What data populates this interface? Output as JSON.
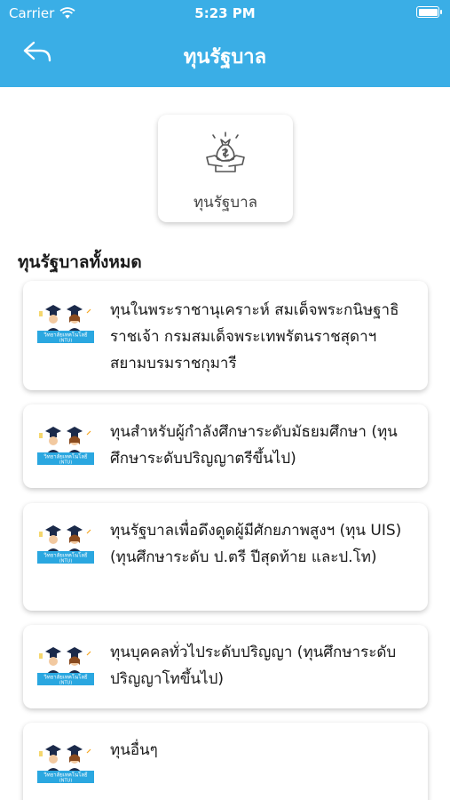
{
  "status_bar": {
    "carrier": "Carrier",
    "time": "5:23 PM"
  },
  "nav": {
    "title": "ทุนรัฐบาล",
    "back_icon": "back-arrow-icon"
  },
  "category": {
    "label": "ทุนรัฐบาล",
    "icon": "money-bag-hands-icon"
  },
  "section": {
    "title": "ทุนรัฐบาลทั้งหมด"
  },
  "scholarships": [
    {
      "title": "ทุนในพระราชานุเคราะห์ สมเด็จพระกนิษฐาธิราชเจ้า กรมสมเด็จพระเทพรัตนราชสุดาฯ สยามบรมราชกุมารี"
    },
    {
      "title": "ทุนสำหรับผู้กำลังศึกษาระดับมัธยมศึกษา (ทุนศึกษาระดับปริญญาตรีขึ้นไป)"
    },
    {
      "title": "ทุนรัฐบาลเพื่อดึงดูดผู้มีศักยภาพสูงฯ (ทุน UIS)(ทุนศึกษาระดับ ป.ตรี ปีสุดท้าย และป.โท)"
    },
    {
      "title": "ทุนบุคคลทั่วไประดับปริญญา (ทุนศึกษาระดับปริญญาโทขึ้นไป)"
    },
    {
      "title": "ทุนอื่นๆ"
    }
  ],
  "thumb_banner_text": "วิทยาลัยเทคโนโลยี (NTU)",
  "colors": {
    "header": "#3aaee6",
    "banner": "#2aa7e0"
  }
}
